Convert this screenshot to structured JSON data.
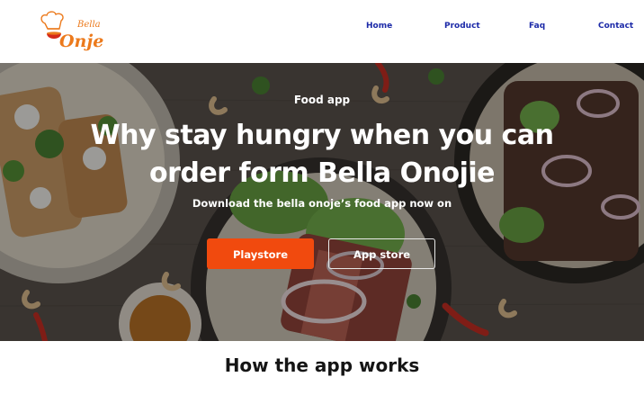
{
  "brand": {
    "logo_small": "Bella",
    "logo_large": "Onje"
  },
  "nav": {
    "items": [
      {
        "label": "Home"
      },
      {
        "label": "Product"
      },
      {
        "label": "Faq"
      },
      {
        "label": "Contact"
      }
    ]
  },
  "hero": {
    "eyebrow": "Food app",
    "headline_line1": "Why stay hungry when you can",
    "headline_line2": "order form Bella Onojie",
    "subline": "Download the bella onoje’s food app now on",
    "primary_button": "Playstore",
    "secondary_button": "App store"
  },
  "how_it_works": {
    "title": "How the app works"
  },
  "colors": {
    "nav_link": "#1c2aa8",
    "primary_button": "#f14a0e",
    "logo_orange": "#ec7a1c",
    "logo_red": "#d42a1a"
  }
}
